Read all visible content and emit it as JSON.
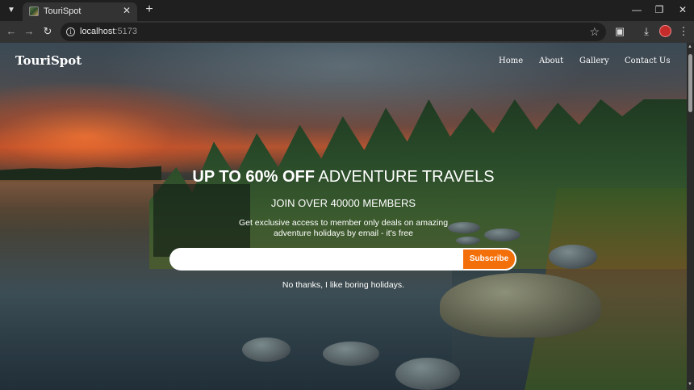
{
  "browser": {
    "tab_title": "TouriSpot",
    "new_tab": "+",
    "tab_close": "✕",
    "url_host": "localhost",
    "url_port": ":5173"
  },
  "site": {
    "brand": "TouriSpot",
    "nav": [
      "Home",
      "About",
      "Gallery",
      "Contact Us"
    ]
  },
  "hero": {
    "headline_strong": "UP TO 60% OFF",
    "headline_rest": "ADVENTURE TRAVELS",
    "subhead": "JOIN OVER 40000 MEMBERS",
    "desc_line1": "Get exclusive access to member only deals on amazing",
    "desc_line2": "adventure holidays by email - it's free",
    "email_placeholder": "",
    "subscribe_label": "Subscribe",
    "no_thanks": "No thanks, I like boring holidays."
  },
  "colors": {
    "accent": "#f36f0a",
    "chrome_dark": "#1f1f1f",
    "chrome_mid": "#333333"
  }
}
